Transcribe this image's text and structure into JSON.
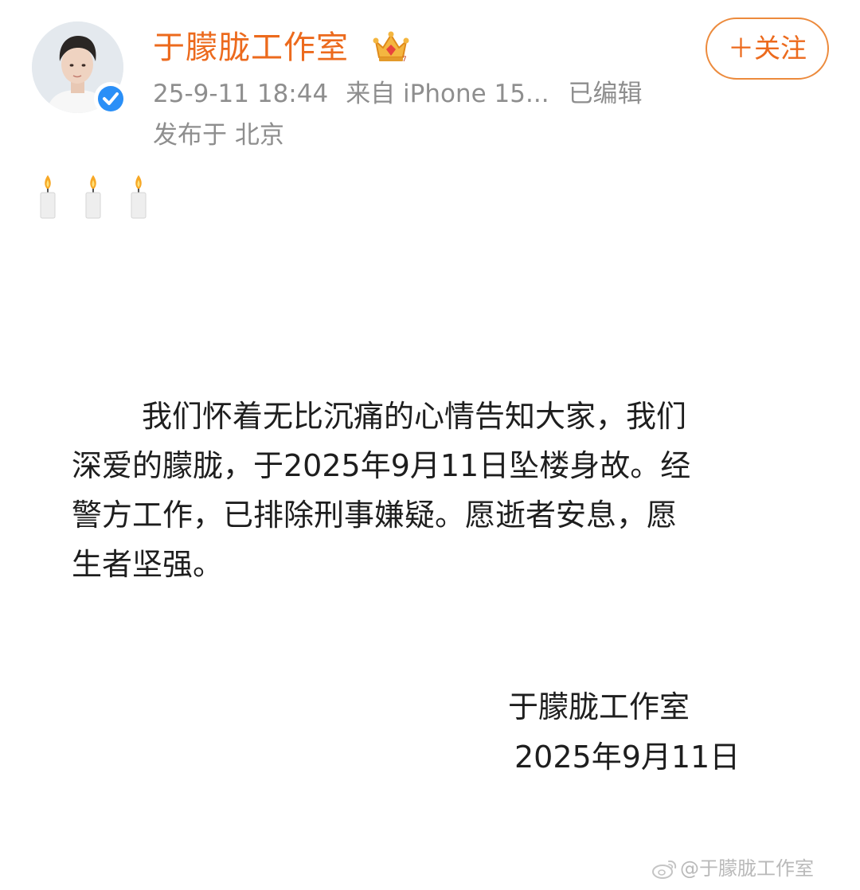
{
  "post": {
    "author": {
      "name": "于朦胧工作室",
      "avatar": "avatar-portrait",
      "verified_icon": "verified-check-icon",
      "vip_icon": "crown-icon"
    },
    "meta": {
      "time": "25-9-11 18:44",
      "source": "来自 iPhone 15...",
      "edited": "已编辑",
      "location": "发布于 北京"
    },
    "follow_label": "＋关注",
    "emoji": [
      "candle-icon",
      "candle-icon",
      "candle-icon"
    ],
    "statement_lines": [
      "我们怀着无比沉痛的心情告知大家，我们",
      "深爱的朦胧，于2025年9月11日坠楼身故。经",
      "警方工作，已排除刑事嫌疑。愿逝者安息，愿",
      "生者坚强。"
    ],
    "signature": "于朦胧工作室",
    "date": "2025年9月11日"
  },
  "watermark": {
    "icon": "weibo-logo-icon",
    "text": "@于朦胧工作室"
  },
  "colors": {
    "accent": "#ec6a1d",
    "meta_text": "#8e8e8e",
    "verified": "#2a8ff7",
    "body_text": "#1e1e1e",
    "watermark": "#b9b9b9"
  }
}
